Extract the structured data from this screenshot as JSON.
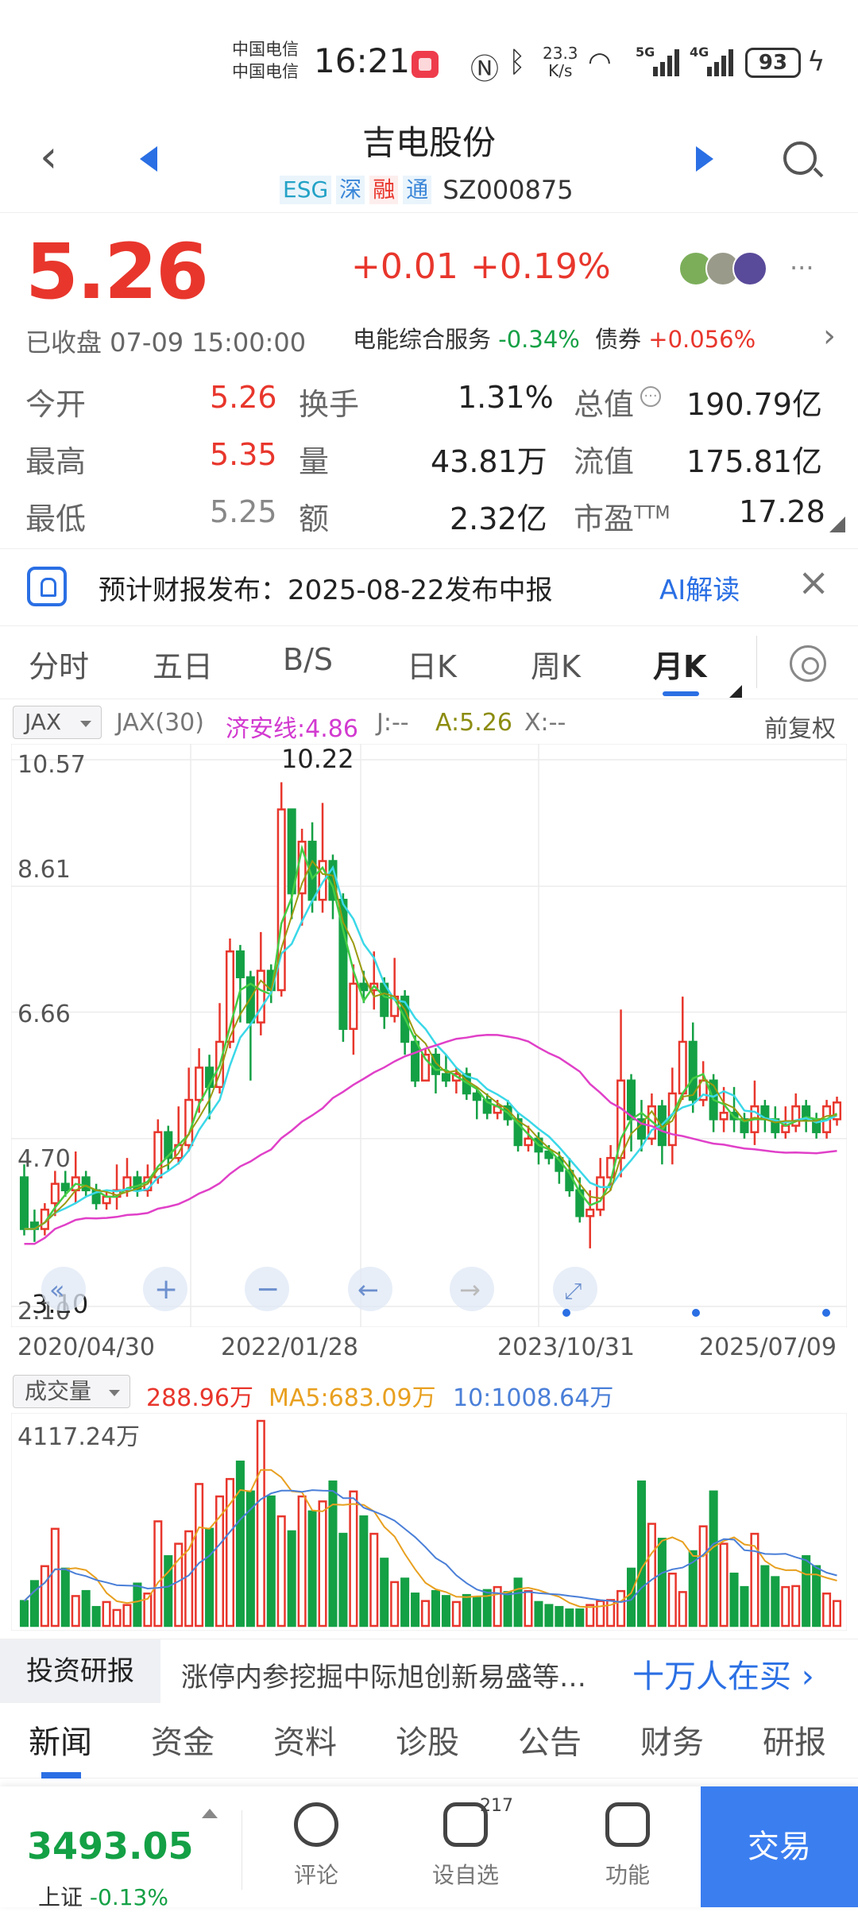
{
  "status_bar": {
    "carrier_1": "中国电信",
    "carrier_2": "中国电信",
    "time": "16:21",
    "net_speed_value": "23.3",
    "net_speed_unit": "K/s",
    "sig1": "5G",
    "sig2": "4G",
    "battery": "93"
  },
  "header": {
    "stock_name": "吉电股份",
    "tags": [
      "ESG",
      "深",
      "融",
      "通"
    ],
    "code": "SZ000875"
  },
  "quote": {
    "price": "5.26",
    "change": "+0.01",
    "change_pct": "+0.19%",
    "status": "已收盘 07-09 15:00:00",
    "sector_name": "电能综合服务",
    "sector_pct": "-0.34%",
    "bond_name": "债券",
    "bond_pct": "+0.056%"
  },
  "stats": {
    "open_label": "今开",
    "open": "5.26",
    "high_label": "最高",
    "high": "5.35",
    "low_label": "最低",
    "low": "5.25",
    "turnover_label": "换手",
    "turnover": "1.31%",
    "volume_label": "量",
    "volume": "43.81万",
    "amount_label": "额",
    "amount": "2.32亿",
    "mcap_label": "总值",
    "mcap": "190.79亿",
    "float_label": "流值",
    "float_cap": "175.81亿",
    "pe_label": "市盈",
    "pe_sup": "TTM",
    "pe": "17.28"
  },
  "banner": {
    "text": "预计财报发布：2025-08-22发布中报",
    "ai_label": "AI解读"
  },
  "chart_tabs": [
    "分时",
    "五日",
    "B/S",
    "日K",
    "周K",
    "月K"
  ],
  "indicator": {
    "dropdown": "JAX",
    "name": "JAX(30)",
    "jax_line": "济安线:4.86",
    "j": "J:--",
    "a": "A:5.26",
    "x": "X:--",
    "adjust": "前复权"
  },
  "volume_indicator": {
    "dropdown": "成交量",
    "vol": "288.96万",
    "ma5": "MA5:683.09万",
    "ma10": "10:1008.64万"
  },
  "chart_data": [
    {
      "type": "candlestick",
      "ylim": [
        2.1,
        10.57
      ],
      "y_ticks": [
        "10.57",
        "8.61",
        "6.66",
        "4.70",
        "2.10"
      ],
      "x_ticks": [
        "2020/04/30",
        "2022/01/28",
        "2023/10/31",
        "2025/07/09"
      ],
      "max_label": "10.22",
      "min_label": "3.10",
      "colors": {
        "up": "#e8362c",
        "down": "#14a045",
        "ma_pink": "#e040c8",
        "ma_cyan": "#3ad8e8",
        "ma_green": "#44cc44",
        "ma_olive": "#9a9a10"
      },
      "candles": [
        [
          4.1,
          3.3,
          4.3,
          3.2
        ],
        [
          3.4,
          3.3,
          3.6,
          3.1
        ],
        [
          3.3,
          3.6,
          3.7,
          3.2
        ],
        [
          3.7,
          4.0,
          4.2,
          3.5
        ],
        [
          4.0,
          3.9,
          4.2,
          3.8
        ],
        [
          3.9,
          4.1,
          4.5,
          3.7
        ],
        [
          4.1,
          3.9,
          4.2,
          3.8
        ],
        [
          3.9,
          3.7,
          4.0,
          3.6
        ],
        [
          3.7,
          3.8,
          3.9,
          3.6
        ],
        [
          3.8,
          3.9,
          4.3,
          3.6
        ],
        [
          3.9,
          4.1,
          4.4,
          3.8
        ],
        [
          4.1,
          3.9,
          4.2,
          3.8
        ],
        [
          3.9,
          4.1,
          4.3,
          3.8
        ],
        [
          4.1,
          4.8,
          5.0,
          4.0
        ],
        [
          4.8,
          4.4,
          4.9,
          4.2
        ],
        [
          4.4,
          4.6,
          5.2,
          4.3
        ],
        [
          4.6,
          5.3,
          5.8,
          4.5
        ],
        [
          5.3,
          5.8,
          6.1,
          5.1
        ],
        [
          5.8,
          5.5,
          6.0,
          5.0
        ],
        [
          5.5,
          6.2,
          6.8,
          5.4
        ],
        [
          6.2,
          7.6,
          7.8,
          6.1
        ],
        [
          7.6,
          7.2,
          7.7,
          6.5
        ],
        [
          7.2,
          6.5,
          7.3,
          5.6
        ],
        [
          6.5,
          7.3,
          7.9,
          6.3
        ],
        [
          7.3,
          7.0,
          7.4,
          6.8
        ],
        [
          7.0,
          9.8,
          10.22,
          6.9
        ],
        [
          9.8,
          8.5,
          9.8,
          8.1
        ],
        [
          8.5,
          9.3,
          9.5,
          8.0
        ],
        [
          9.3,
          8.4,
          9.6,
          8.2
        ],
        [
          8.4,
          9.0,
          9.9,
          8.2
        ],
        [
          9.0,
          8.4,
          9.1,
          8.1
        ],
        [
          8.4,
          6.4,
          8.5,
          6.2
        ],
        [
          6.4,
          7.1,
          7.4,
          6.0
        ],
        [
          7.1,
          7.0,
          7.3,
          6.8
        ],
        [
          7.0,
          7.1,
          7.6,
          6.7
        ],
        [
          7.1,
          6.6,
          7.2,
          6.4
        ],
        [
          6.6,
          6.9,
          7.5,
          6.5
        ],
        [
          6.9,
          6.2,
          7.0,
          6.0
        ],
        [
          6.2,
          5.6,
          6.3,
          5.5
        ],
        [
          5.6,
          6.0,
          6.1,
          5.6
        ],
        [
          6.0,
          5.7,
          6.1,
          5.4
        ],
        [
          5.7,
          5.6,
          6.0,
          5.5
        ],
        [
          5.6,
          5.7,
          5.8,
          5.4
        ],
        [
          5.7,
          5.4,
          5.8,
          5.3
        ],
        [
          5.4,
          5.3,
          5.5,
          5.0
        ],
        [
          5.3,
          5.1,
          5.4,
          5.0
        ],
        [
          5.1,
          5.2,
          5.3,
          5.0
        ],
        [
          5.2,
          5.0,
          5.3,
          4.9
        ],
        [
          5.0,
          4.6,
          5.1,
          4.5
        ],
        [
          4.6,
          4.7,
          4.9,
          4.5
        ],
        [
          4.7,
          4.5,
          4.8,
          4.3
        ],
        [
          4.5,
          4.4,
          4.6,
          4.3
        ],
        [
          4.4,
          4.2,
          4.5,
          4.0
        ],
        [
          4.2,
          3.9,
          4.4,
          3.8
        ],
        [
          3.9,
          3.5,
          4.1,
          3.4
        ],
        [
          3.5,
          3.6,
          3.9,
          3.0
        ],
        [
          3.6,
          4.1,
          4.4,
          3.5
        ],
        [
          4.1,
          4.4,
          4.6,
          3.9
        ],
        [
          4.4,
          5.6,
          6.7,
          4.1
        ],
        [
          5.6,
          5.0,
          5.7,
          4.5
        ],
        [
          5.0,
          4.7,
          5.3,
          4.5
        ],
        [
          4.7,
          5.2,
          5.4,
          4.6
        ],
        [
          5.2,
          4.6,
          5.3,
          4.3
        ],
        [
          4.6,
          5.4,
          5.8,
          4.3
        ],
        [
          5.4,
          6.2,
          6.9,
          5.3
        ],
        [
          6.2,
          5.3,
          6.5,
          5.1
        ],
        [
          5.3,
          5.6,
          5.9,
          5.2
        ],
        [
          5.6,
          5.0,
          5.7,
          4.8
        ],
        [
          5.0,
          5.1,
          5.5,
          4.8
        ],
        [
          5.1,
          5.0,
          5.5,
          4.8
        ],
        [
          5.0,
          4.8,
          5.1,
          4.7
        ],
        [
          4.8,
          5.2,
          5.6,
          4.6
        ],
        [
          5.2,
          5.0,
          5.3,
          4.8
        ],
        [
          5.0,
          4.8,
          5.2,
          4.7
        ],
        [
          4.8,
          4.9,
          5.2,
          4.7
        ],
        [
          4.9,
          5.2,
          5.4,
          4.8
        ],
        [
          5.2,
          5.0,
          5.3,
          4.8
        ],
        [
          5.0,
          4.8,
          5.1,
          4.7
        ],
        [
          4.8,
          5.2,
          5.3,
          4.7
        ],
        [
          5.0,
          5.26,
          5.35,
          4.9
        ]
      ]
    },
    {
      "type": "bar",
      "title": "成交量",
      "y_max_label": "4117.24万",
      "ylim": [
        0,
        4117.24
      ],
      "volumes": [
        500,
        900,
        1200,
        1950,
        1150,
        600,
        700,
        380,
        480,
        320,
        420,
        850,
        650,
        2100,
        1400,
        1650,
        1900,
        2850,
        1950,
        2600,
        2950,
        3300,
        2700,
        4117,
        2600,
        2200,
        1900,
        2600,
        2300,
        2500,
        2900,
        1850,
        2700,
        2200,
        1850,
        1350,
        880,
        950,
        650,
        500,
        700,
        600,
        480,
        620,
        580,
        720,
        780,
        680,
        950,
        700,
        480,
        420,
        380,
        330,
        330,
        420,
        500,
        520,
        700,
        1150,
        2900,
        2050,
        1750,
        1050,
        680,
        1500,
        2000,
        2700,
        1650,
        1050,
        780,
        1850,
        1200,
        980,
        780,
        800,
        1400,
        1200,
        650,
        500
      ]
    }
  ],
  "research": {
    "label": "投资研报",
    "text": "涨停内参挖掘中际旭创新易盛等…",
    "link": "十万人在买"
  },
  "news_tabs": [
    "新闻",
    "资金",
    "资料",
    "诊股",
    "公告",
    "财务",
    "研报"
  ],
  "bottom_bar": {
    "index_value": "3493.05",
    "index_name": "上证",
    "index_pct": "-0.13%",
    "comment": "评论",
    "watch": "设自选",
    "watch_badge": "217",
    "func": "功能",
    "trade": "交易"
  }
}
